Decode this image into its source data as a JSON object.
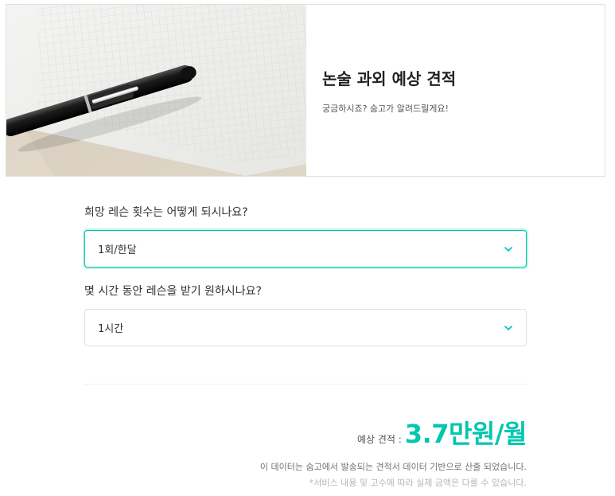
{
  "hero": {
    "title": "논술 과외 예상 견적",
    "subtitle": "궁금하시죠? 숨고가 알려드릴게요!",
    "image_icon": "pen-on-paper-image"
  },
  "questions": [
    {
      "label": "희망 레슨 횟수는 어떻게 되시나요?",
      "value": "1회/한달"
    },
    {
      "label": "몇 시간 동안 레슨을 받기 원하시나요?",
      "value": "1시간"
    }
  ],
  "estimate": {
    "label": "예상 견적 :",
    "value": "3.7만원/월"
  },
  "notes": {
    "line1": "이 데이터는 숨고에서 발송되는 견적서 데이터 기반으로 산출 되었습니다.",
    "line2": "*서비스 내용 및 고수에 따라 실제 금액은 다를 수 있습니다."
  },
  "colors": {
    "accent": "#00c7ae",
    "border": "#e1e1e1"
  }
}
